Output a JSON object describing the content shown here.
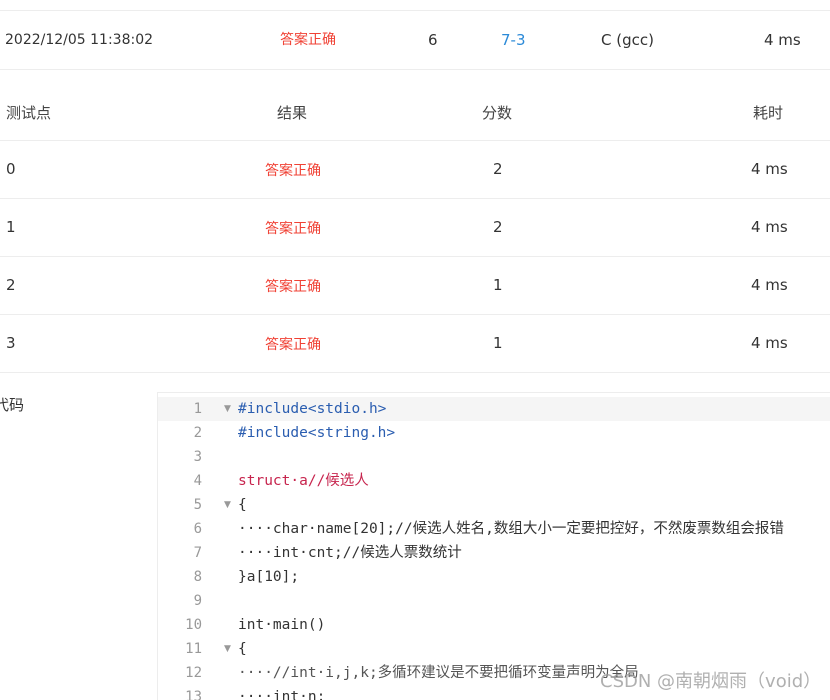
{
  "submission": {
    "time": "2022/12/05 11:38:02",
    "status": "答案正确",
    "score": "6",
    "problem": "7-3",
    "compiler": "C (gcc)",
    "elapsed": "4 ms"
  },
  "testcases": {
    "headers": {
      "point": "测试点",
      "result": "结果",
      "score": "分数",
      "time": "耗时"
    },
    "rows": [
      {
        "point": "0",
        "result": "答案正确",
        "score": "2",
        "time": "4 ms"
      },
      {
        "point": "1",
        "result": "答案正确",
        "score": "2",
        "time": "4 ms"
      },
      {
        "point": "2",
        "result": "答案正确",
        "score": "1",
        "time": "4 ms"
      },
      {
        "point": "3",
        "result": "答案正确",
        "score": "1",
        "time": "4 ms"
      }
    ]
  },
  "code_label": "代码",
  "code_lines": [
    {
      "n": "1",
      "text": "#include<stdio.h>"
    },
    {
      "n": "2",
      "text": "#include<string.h>"
    },
    {
      "n": "3",
      "text": ""
    },
    {
      "n": "4",
      "text": "struct·a//候选人"
    },
    {
      "n": "5",
      "text": "{"
    },
    {
      "n": "6",
      "text": "····char·name[20];//候选人姓名,数组大小一定要把控好，不然废票数组会报错"
    },
    {
      "n": "7",
      "text": "····int·cnt;//候选人票数统计"
    },
    {
      "n": "8",
      "text": "}a[10];"
    },
    {
      "n": "9",
      "text": ""
    },
    {
      "n": "10",
      "text": "int·main()"
    },
    {
      "n": "11",
      "text": "{"
    },
    {
      "n": "12",
      "text": "····//int·i,j,k;多循环建议是不要把循环变量声明为全局"
    },
    {
      "n": "13",
      "text": "····int·n;"
    }
  ],
  "watermark": "CSDN @南朝烟雨（void）",
  "colors": {
    "status": "#f04134",
    "link": "#2b8ad8",
    "border": "#ededed"
  }
}
